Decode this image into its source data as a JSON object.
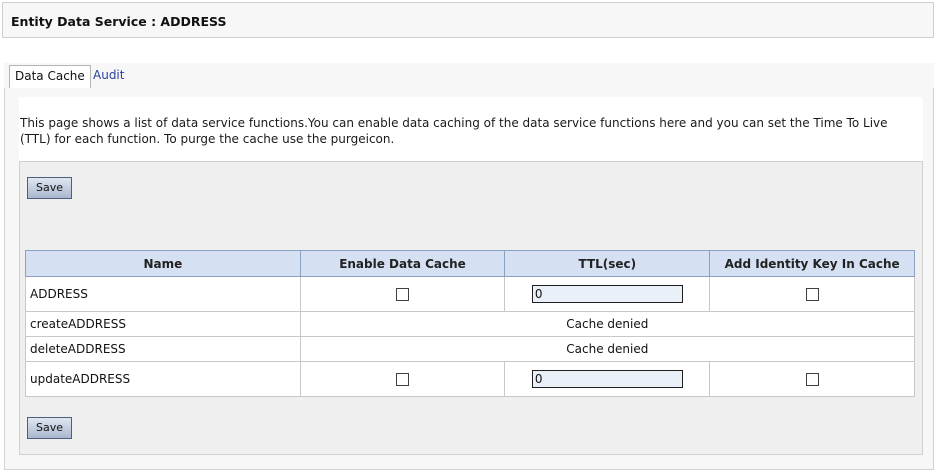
{
  "header": {
    "title": "Entity Data Service : ADDRESS"
  },
  "tabs": [
    {
      "label": "Data Cache",
      "active": true
    },
    {
      "label": "Audit",
      "active": false
    }
  ],
  "description": "This page shows a list of data service functions.You can enable data caching of the data service functions here and you can set the Time To Live (TTL) for each function. To purge the cache use the purgeicon.",
  "buttons": {
    "save_top": "Save",
    "save_bottom": "Save"
  },
  "table": {
    "columns": [
      "Name",
      "Enable Data Cache",
      "TTL(sec)",
      "Add Identity Key In Cache"
    ],
    "rows": [
      {
        "name": "ADDRESS",
        "enable_cache": false,
        "ttl": "0",
        "add_identity_key": false
      },
      {
        "name": "createADDRESS",
        "status": "Cache denied"
      },
      {
        "name": "deleteADDRESS",
        "status": "Cache denied"
      },
      {
        "name": "updateADDRESS",
        "enable_cache": false,
        "ttl": "0",
        "add_identity_key": false
      }
    ]
  },
  "colors": {
    "header_bg": "#d5e1f2",
    "button_border": "#4f5e7c",
    "link_tab": "#2a3f9c"
  }
}
